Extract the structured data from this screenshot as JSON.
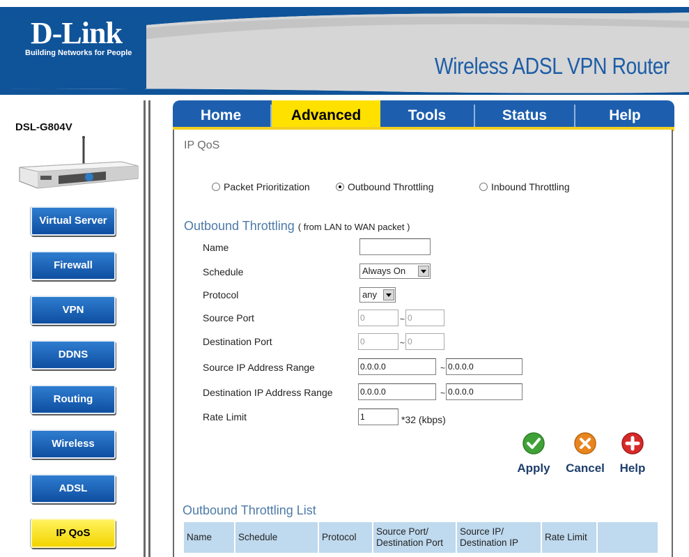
{
  "header": {
    "brand": "D-Link",
    "tagline": "Building Networks for People",
    "product_title": "Wireless ADSL VPN Router",
    "colors": {
      "band": "#0f5399",
      "title": "#1d5da7"
    }
  },
  "sidebar": {
    "model": "DSL-G804V",
    "items": [
      {
        "label": "Virtual Server"
      },
      {
        "label": "Firewall"
      },
      {
        "label": "VPN"
      },
      {
        "label": "DDNS"
      },
      {
        "label": "Routing"
      },
      {
        "label": "Wireless"
      },
      {
        "label": "ADSL"
      },
      {
        "label": "IP QoS",
        "active": true
      }
    ]
  },
  "tabs": [
    {
      "label": "Home"
    },
    {
      "label": "Advanced",
      "active": true
    },
    {
      "label": "Tools"
    },
    {
      "label": "Status"
    },
    {
      "label": "Help"
    }
  ],
  "main": {
    "page_title": "IP QoS",
    "mode_options": [
      {
        "label": "Packet Prioritization",
        "selected": false
      },
      {
        "label": "Outbound Throttling",
        "selected": true
      },
      {
        "label": "Inbound Throttling",
        "selected": false
      }
    ],
    "section_title": "Outbound Throttling",
    "section_subtitle": "( from LAN to WAN packet )",
    "form": {
      "name": {
        "label": "Name",
        "value": ""
      },
      "schedule": {
        "label": "Schedule",
        "value": "Always On"
      },
      "protocol": {
        "label": "Protocol",
        "value": "any"
      },
      "source_port": {
        "label": "Source Port",
        "from": "0",
        "to": "0"
      },
      "destination_port": {
        "label": "Destination Port",
        "from": "0",
        "to": "0"
      },
      "source_ip_range": {
        "label": "Source IP Address Range",
        "from": "0.0.0.0",
        "to": "0.0.0.0"
      },
      "destination_ip_range": {
        "label": "Destination IP Address Range",
        "from": "0.0.0.0",
        "to": "0.0.0.0"
      },
      "rate_limit": {
        "label": "Rate Limit",
        "value": "1",
        "unit": "*32 (kbps)"
      },
      "range_sep": "~"
    },
    "actions": {
      "apply": {
        "label": "Apply",
        "icon": "check-icon",
        "color": "#3fa236"
      },
      "cancel": {
        "label": "Cancel",
        "icon": "x-icon",
        "color": "#e8851f"
      },
      "help": {
        "label": "Help",
        "icon": "plus-icon",
        "color": "#d62a2a"
      }
    },
    "list": {
      "title": "Outbound Throttling List",
      "columns": [
        "Name",
        "Schedule",
        "Protocol",
        "Source Port/ Destination Port",
        "Source IP/ Destination IP",
        "Rate Limit",
        ""
      ]
    }
  }
}
